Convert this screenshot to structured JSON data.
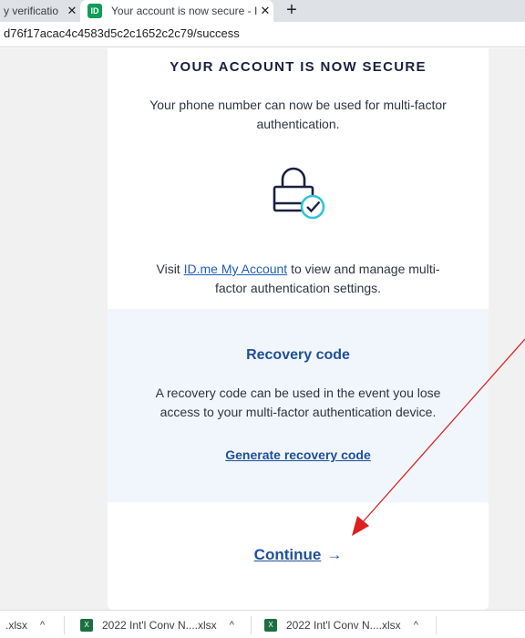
{
  "browser": {
    "tabs": [
      {
        "title": "y verificatio",
        "close": "✕"
      },
      {
        "favicon": "ID",
        "title": "Your account is now secure - ID.m",
        "close": "✕"
      }
    ],
    "new_tab": "+",
    "url": "d76f17acac4c4583d5c2c1652c2c79/success"
  },
  "page": {
    "heading": "YOUR ACCOUNT IS NOW SECURE",
    "subtext": "Your phone number can now be used for multi-factor authentication.",
    "lock_icon": "lock-check-icon",
    "visit_prefix": "Visit ",
    "visit_link": "ID.me My Account",
    "visit_suffix": " to view and manage multi-factor authentication settings.",
    "recovery": {
      "title": "Recovery code",
      "text": "A recovery code can be used in the event you lose access to your multi-factor authentication device.",
      "link": "Generate recovery code"
    },
    "continue_label": "Continue",
    "continue_arrow": "→"
  },
  "colors": {
    "accent": "#1f4f9a",
    "link": "#1f5fb8",
    "recovery_bg": "#f0f6fc",
    "annotation": "#e02020",
    "check_teal": "#2ec4d6"
  },
  "downloads": [
    {
      "name": ".xlsx",
      "chevron": "^"
    },
    {
      "name": "2022 Int'l Conv N....xlsx",
      "chevron": "^"
    },
    {
      "name": "2022 Int'l Conv N....xlsx",
      "chevron": "^"
    }
  ]
}
